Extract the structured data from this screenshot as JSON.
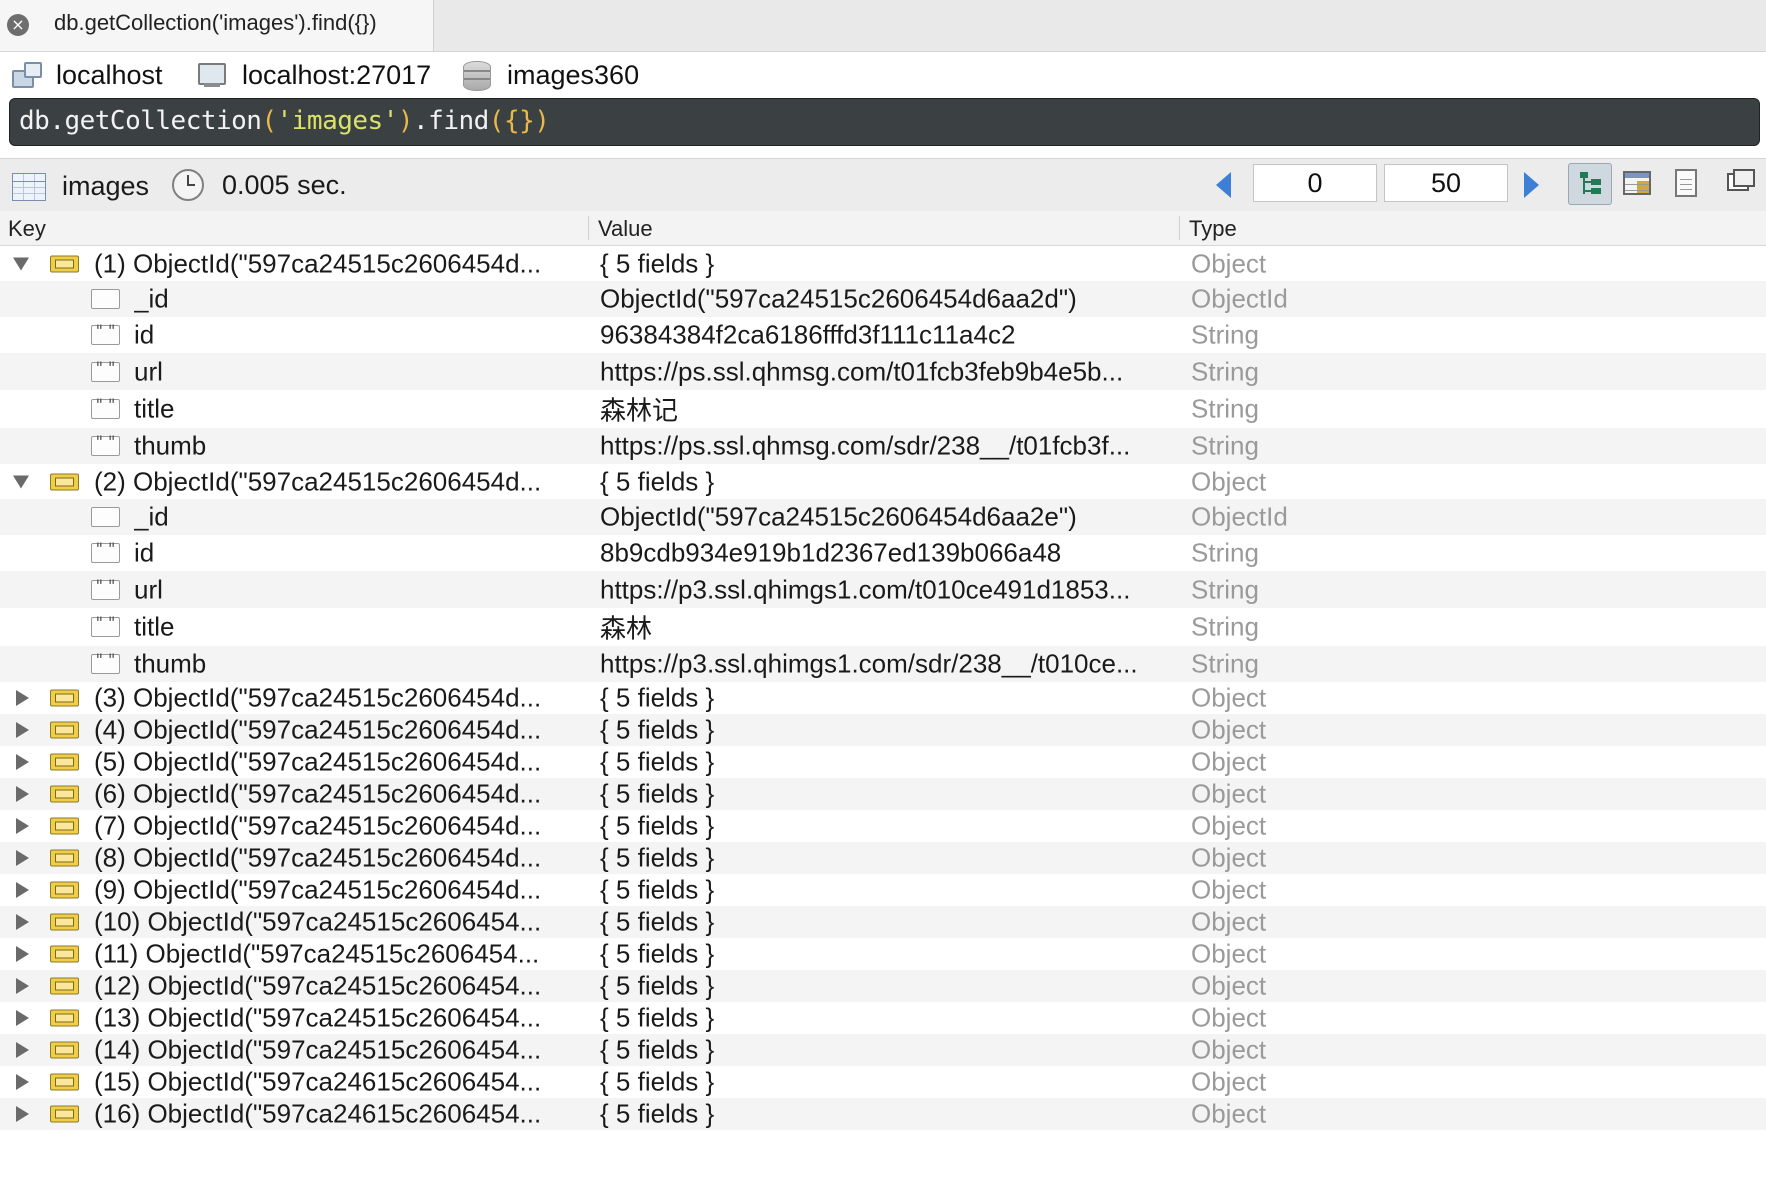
{
  "tab": {
    "label": "db.getCollection('images').find({})"
  },
  "connection": {
    "host": "localhost",
    "server": "localhost:27017",
    "database": "images360"
  },
  "query": {
    "db": "db",
    "fn": "getCollection",
    "arg": "'images'",
    "method": "find",
    "braces": "{}"
  },
  "toolbar": {
    "collection": "images",
    "time": "0.005 sec.",
    "skip": "0",
    "limit": "50"
  },
  "columns": {
    "key": "Key",
    "value": "Value",
    "type": "Type"
  },
  "rows": [
    {
      "kind": "obj",
      "expanded": true,
      "key": "(1) ObjectId(\"597ca24515c2606454d...",
      "value": "{ 5 fields }",
      "type": "Object"
    },
    {
      "kind": "fld",
      "icon": "oid",
      "key": "_id",
      "value": "ObjectId(\"597ca24515c2606454d6aa2d\")",
      "type": "ObjectId"
    },
    {
      "kind": "fld",
      "icon": "str",
      "key": "id",
      "value": "96384384f2ca6186fffd3f111c11a4c2",
      "type": "String"
    },
    {
      "kind": "fld",
      "icon": "str",
      "key": "url",
      "value": "https://ps.ssl.qhmsg.com/t01fcb3feb9b4e5b...",
      "type": "String"
    },
    {
      "kind": "fld",
      "icon": "str",
      "key": "title",
      "value": "森林记",
      "type": "String"
    },
    {
      "kind": "fld",
      "icon": "str",
      "key": "thumb",
      "value": "https://ps.ssl.qhmsg.com/sdr/238__/t01fcb3f...",
      "type": "String"
    },
    {
      "kind": "obj",
      "expanded": true,
      "key": "(2) ObjectId(\"597ca24515c2606454d...",
      "value": "{ 5 fields }",
      "type": "Object"
    },
    {
      "kind": "fld",
      "icon": "oid",
      "key": "_id",
      "value": "ObjectId(\"597ca24515c2606454d6aa2e\")",
      "type": "ObjectId"
    },
    {
      "kind": "fld",
      "icon": "str",
      "key": "id",
      "value": "8b9cdb934e919b1d2367ed139b066a48",
      "type": "String"
    },
    {
      "kind": "fld",
      "icon": "str",
      "key": "url",
      "value": "https://p3.ssl.qhimgs1.com/t010ce491d1853...",
      "type": "String"
    },
    {
      "kind": "fld",
      "icon": "str",
      "key": "title",
      "value": "森林",
      "type": "String"
    },
    {
      "kind": "fld",
      "icon": "str",
      "key": "thumb",
      "value": "https://p3.ssl.qhimgs1.com/sdr/238__/t010ce...",
      "type": "String"
    },
    {
      "kind": "obj",
      "expanded": false,
      "key": "(3) ObjectId(\"597ca24515c2606454d...",
      "value": "{ 5 fields }",
      "type": "Object"
    },
    {
      "kind": "obj",
      "expanded": false,
      "key": "(4) ObjectId(\"597ca24515c2606454d...",
      "value": "{ 5 fields }",
      "type": "Object"
    },
    {
      "kind": "obj",
      "expanded": false,
      "key": "(5) ObjectId(\"597ca24515c2606454d...",
      "value": "{ 5 fields }",
      "type": "Object"
    },
    {
      "kind": "obj",
      "expanded": false,
      "key": "(6) ObjectId(\"597ca24515c2606454d...",
      "value": "{ 5 fields }",
      "type": "Object"
    },
    {
      "kind": "obj",
      "expanded": false,
      "key": "(7) ObjectId(\"597ca24515c2606454d...",
      "value": "{ 5 fields }",
      "type": "Object"
    },
    {
      "kind": "obj",
      "expanded": false,
      "key": "(8) ObjectId(\"597ca24515c2606454d...",
      "value": "{ 5 fields }",
      "type": "Object"
    },
    {
      "kind": "obj",
      "expanded": false,
      "key": "(9) ObjectId(\"597ca24515c2606454d...",
      "value": "{ 5 fields }",
      "type": "Object"
    },
    {
      "kind": "obj",
      "expanded": false,
      "key": "(10) ObjectId(\"597ca24515c2606454...",
      "value": "{ 5 fields }",
      "type": "Object"
    },
    {
      "kind": "obj",
      "expanded": false,
      "key": "(11) ObjectId(\"597ca24515c2606454...",
      "value": "{ 5 fields }",
      "type": "Object"
    },
    {
      "kind": "obj",
      "expanded": false,
      "key": "(12) ObjectId(\"597ca24515c2606454...",
      "value": "{ 5 fields }",
      "type": "Object"
    },
    {
      "kind": "obj",
      "expanded": false,
      "key": "(13) ObjectId(\"597ca24515c2606454...",
      "value": "{ 5 fields }",
      "type": "Object"
    },
    {
      "kind": "obj",
      "expanded": false,
      "key": "(14) ObjectId(\"597ca24515c2606454...",
      "value": "{ 5 fields }",
      "type": "Object"
    },
    {
      "kind": "obj",
      "expanded": false,
      "key": "(15) ObjectId(\"597ca24615c2606454...",
      "value": "{ 5 fields }",
      "type": "Object"
    },
    {
      "kind": "obj",
      "expanded": false,
      "key": "(16) ObjectId(\"597ca24615c2606454...",
      "value": "{ 5 fields }",
      "type": "Object"
    }
  ]
}
